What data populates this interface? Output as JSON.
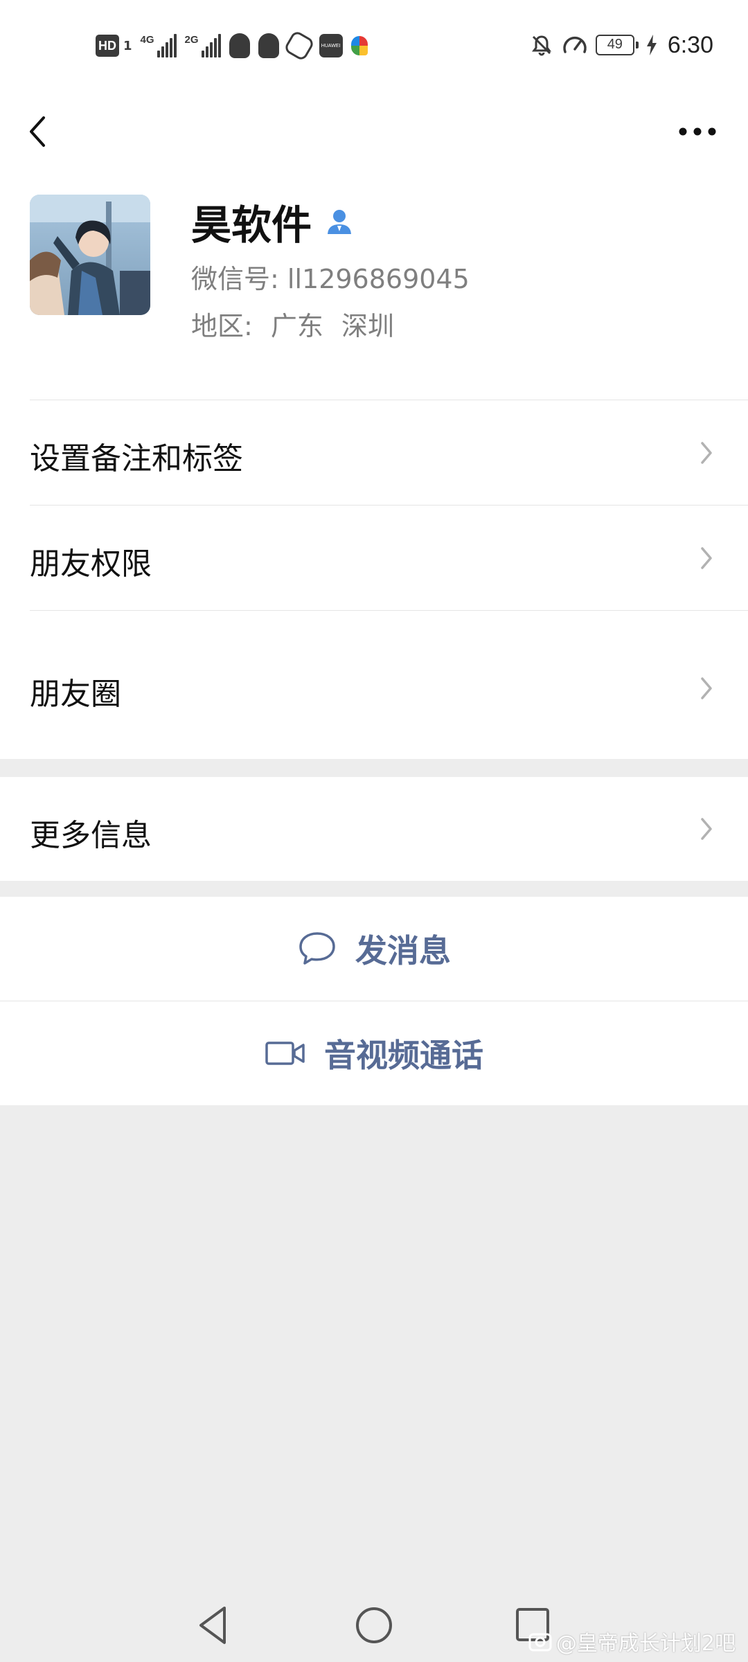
{
  "status_bar": {
    "left_icons": [
      "hd-icon",
      "sim1-icon",
      "signal-4g-icon",
      "signal-2g-icon",
      "qq-icon",
      "qq-icon",
      "hand-hexagon-icon",
      "huawei-app-icon",
      "color-app-icon"
    ],
    "hd_text": "HD",
    "sim_text": "1",
    "net1_label": "4G",
    "net2_label": "2G",
    "huawei_label": "HUAWEI",
    "right_icons": [
      "mute-bell-icon",
      "speedometer-icon",
      "battery-icon",
      "charging-bolt-icon"
    ],
    "battery_level": "49",
    "time": "6:30"
  },
  "nav": {
    "back_icon": "chevron-left-icon",
    "more_icon": "more-dots-icon"
  },
  "profile": {
    "name": "昊软件",
    "contact_icon": "person-contact-icon",
    "wechat_id_label": "微信号:",
    "wechat_id": "ll1296869045",
    "region_label": "地区:",
    "region_province": "广东",
    "region_city": "深圳"
  },
  "menu": {
    "items": [
      {
        "label": "设置备注和标签"
      },
      {
        "label": "朋友权限"
      },
      {
        "label": "朋友圈"
      },
      {
        "label": "更多信息"
      }
    ]
  },
  "actions": {
    "message_label": "发消息",
    "video_call_label": "音视频通话"
  },
  "colors": {
    "accent": "#576b95",
    "background": "#ededed",
    "contact_icon": "#4a90e2"
  },
  "watermark": "@皇帝成长计划2吧"
}
